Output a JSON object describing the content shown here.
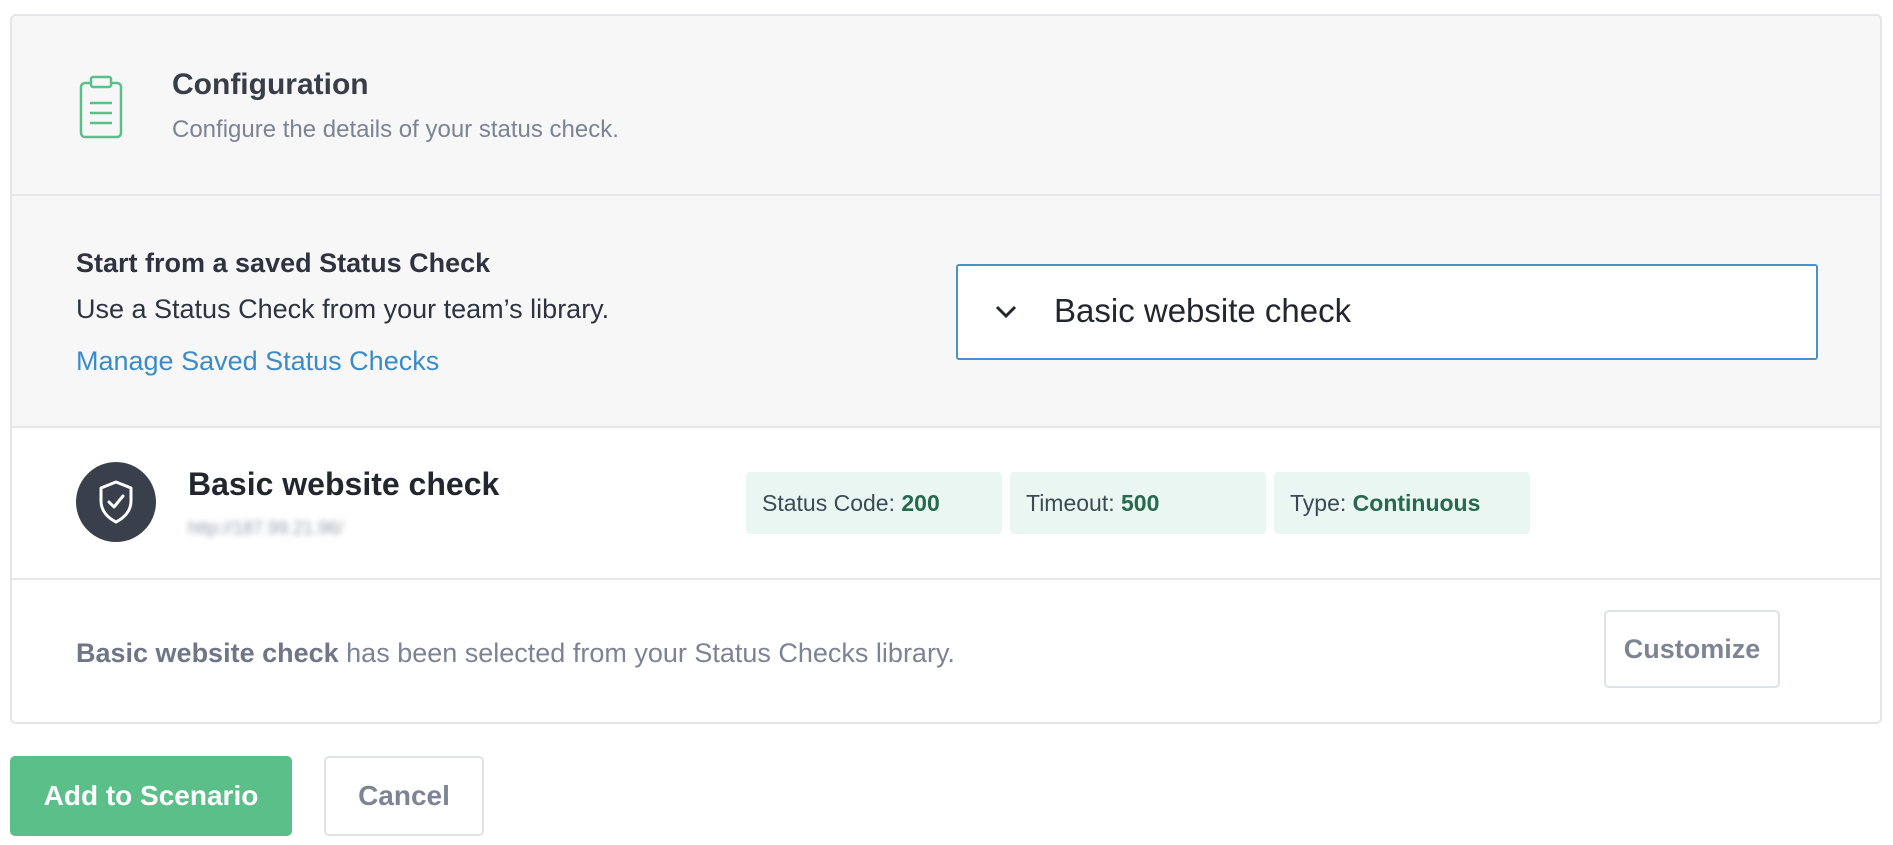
{
  "config": {
    "title": "Configuration",
    "subtitle": "Configure the details of your status check.",
    "icon": "clipboard-icon",
    "accent": "#5bbf8a"
  },
  "saved": {
    "heading": "Start from a saved Status Check",
    "description": "Use a Status Check from your team’s library.",
    "manage_link": "Manage Saved Status Checks",
    "select_value": "Basic website check"
  },
  "check": {
    "name": "Basic website check",
    "url": "http://187.99.21.96/",
    "icon": "shield-check-icon",
    "pills": [
      {
        "label": "Status Code: ",
        "value": "200"
      },
      {
        "label": "Timeout: ",
        "value": "500"
      },
      {
        "label": "Type: ",
        "value": "Continuous"
      }
    ]
  },
  "note": {
    "name": "Basic website check",
    "text": " has been selected from your Status Checks library.",
    "customize_label": "Customize"
  },
  "actions": {
    "add_label": "Add to Scenario",
    "cancel_label": "Cancel"
  }
}
